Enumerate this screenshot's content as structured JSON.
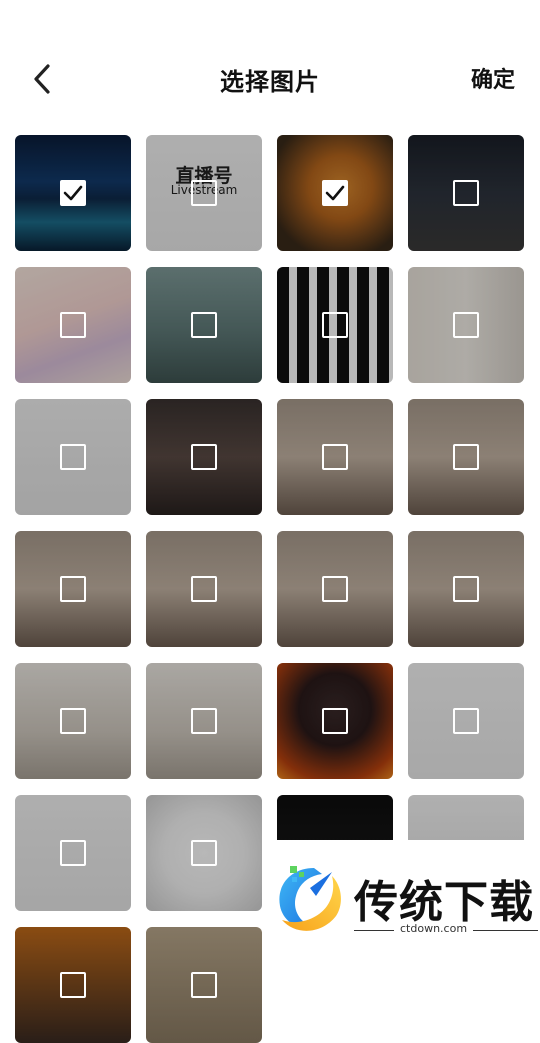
{
  "header": {
    "title": "选择图片",
    "confirm_label": "确定",
    "back_icon": "chevron-left-icon"
  },
  "grid": {
    "columns": 4,
    "items": [
      {
        "name": "photo-night-lake",
        "selected": true
      },
      {
        "name": "photo-livestream-logo",
        "selected": false,
        "logo_text": "直播号",
        "logo_sub": "Livestream"
      },
      {
        "name": "photo-orange-cat",
        "selected": true
      },
      {
        "name": "photo-cat-on-road",
        "selected": false
      },
      {
        "name": "photo-anime-girl",
        "selected": false
      },
      {
        "name": "photo-foggy-forest",
        "selected": false
      },
      {
        "name": "photo-qr-code",
        "selected": false
      },
      {
        "name": "photo-portrait-sketch-pair",
        "selected": false
      },
      {
        "name": "photo-text-screenshot",
        "selected": false
      },
      {
        "name": "photo-woman-dark-top",
        "selected": false
      },
      {
        "name": "photo-woman-portrait-1",
        "selected": false
      },
      {
        "name": "photo-woman-portrait-2",
        "selected": false
      },
      {
        "name": "photo-woman-portrait-3",
        "selected": false
      },
      {
        "name": "photo-woman-portrait-4",
        "selected": false
      },
      {
        "name": "photo-woman-portrait-5",
        "selected": false
      },
      {
        "name": "photo-woman-portrait-6",
        "selected": false
      },
      {
        "name": "photo-sketch-portrait-1",
        "selected": false
      },
      {
        "name": "photo-sketch-portrait-2",
        "selected": false
      },
      {
        "name": "photo-armored-figure-fire",
        "selected": false
      },
      {
        "name": "photo-list-screenshot",
        "selected": false
      },
      {
        "name": "photo-subway-map",
        "selected": false
      },
      {
        "name": "photo-white-dog",
        "selected": false
      },
      {
        "name": "photo-woman-small",
        "selected": false
      },
      {
        "name": "photo-ink-landscape",
        "selected": false
      },
      {
        "name": "photo-warrior-partial",
        "selected": false
      },
      {
        "name": "photo-street-partial",
        "selected": false
      }
    ]
  },
  "watermark": {
    "title": "传统下载",
    "url": "ctdown.com"
  },
  "colors": {
    "check_white": "#ffffff",
    "dim_overlay": "rgba(0,0,0,0.28)"
  }
}
